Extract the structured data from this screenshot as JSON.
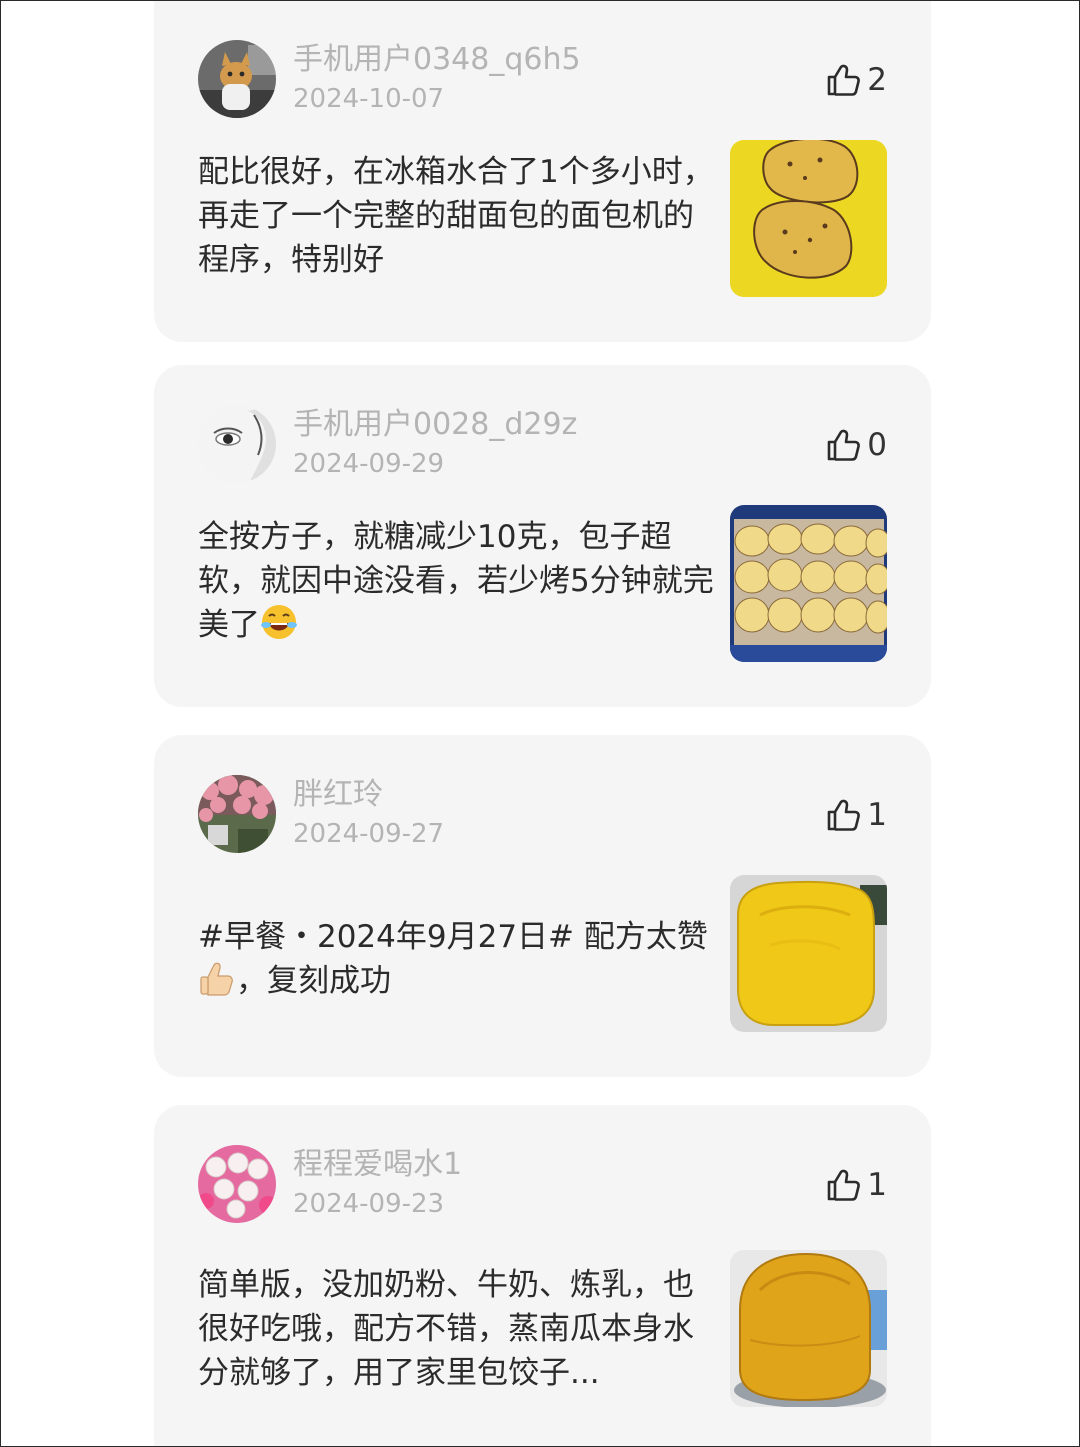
{
  "reviews": [
    {
      "username": "手机用户0348_q6h5",
      "date": "2024-10-07",
      "likes": "2",
      "text": "配比很好，在冰箱水合了1个多小时，再走了一个完整的甜面包的面包机的程序，特别好",
      "avatar": "cat-avatar",
      "photo": "bread-slices-photo"
    },
    {
      "username": "手机用户0028_d29z",
      "date": "2024-09-29",
      "likes": "0",
      "text_before_emoji": "全按方子，就糖减少10克，包子超软，就因中途没看，若少烤5分钟就完美了",
      "emoji": "face-with-tears-of-joy",
      "avatar": "eye-portrait-avatar",
      "photo": "steamed-buns-photo"
    },
    {
      "username": "胖红玲",
      "date": "2024-09-27",
      "likes": "1",
      "text_part1": "#早餐・2024年9月27日# 配方太赞",
      "emoji": "thumbs-up",
      "text_part2": "，复刻成功",
      "avatar": "blossom-avatar",
      "photo": "pumpkin-bread-loaf-photo"
    },
    {
      "username": "程程爱喝水1",
      "date": "2024-09-23",
      "likes": "1",
      "text": "简单版，没加奶粉、牛奶、炼乳，也很好吃哦，配方不错，蒸南瓜本身水分就够了，用了家里包饺子...",
      "avatar": "roses-avatar",
      "photo": "pumpkin-bread-photo"
    }
  ],
  "icons": {
    "like": "thumbs-up-outline-icon"
  },
  "colors": {
    "card_bg": "#f5f5f5",
    "meta_text": "#b4b4b4",
    "body_text": "#2b2b2b"
  }
}
